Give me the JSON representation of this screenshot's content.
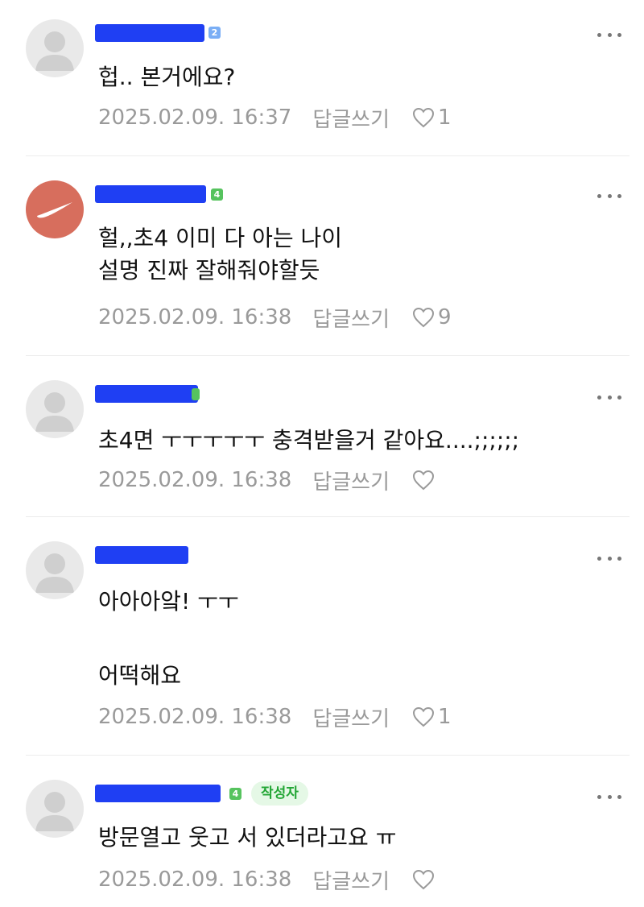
{
  "comments": [
    {
      "level": "2",
      "text": "헙.. 본거에요?",
      "date": "2025.02.09. 16:37",
      "reply_label": "답글쓰기",
      "likes": "1"
    },
    {
      "level": "4",
      "text": "헐,,초4 이미 다 아는 나이\n설명 진짜 잘해줘야할듯",
      "date": "2025.02.09. 16:38",
      "reply_label": "답글쓰기",
      "likes": "9"
    },
    {
      "text": "초4면 ㅜㅜㅜㅜㅜ 충격받을거 같아요....;;;;;;",
      "date": "2025.02.09. 16:38",
      "reply_label": "답글쓰기",
      "likes": ""
    },
    {
      "text": "아아아앜! ㅜㅜ\n\n어떡해요",
      "date": "2025.02.09. 16:38",
      "reply_label": "답글쓰기",
      "likes": "1"
    },
    {
      "level": "4",
      "author_badge": "작성자",
      "text": "방문열고 웃고 서 있더라고요 ㅠ",
      "date": "2025.02.09. 16:38",
      "reply_label": "답글쓰기",
      "likes": ""
    }
  ],
  "icons": {
    "more": "more-dots-icon",
    "like": "heart-outline-icon",
    "avatar_default": "default-avatar-icon",
    "avatar_nike": "nike-swoosh-icon"
  },
  "colors": {
    "redaction": "#1f3ff3",
    "level_blue": "#7aaef5",
    "level_green": "#56c35e",
    "author_badge_bg": "#e5f8e6",
    "author_badge_text": "#23a635",
    "meta_text": "#9a9a9a"
  }
}
